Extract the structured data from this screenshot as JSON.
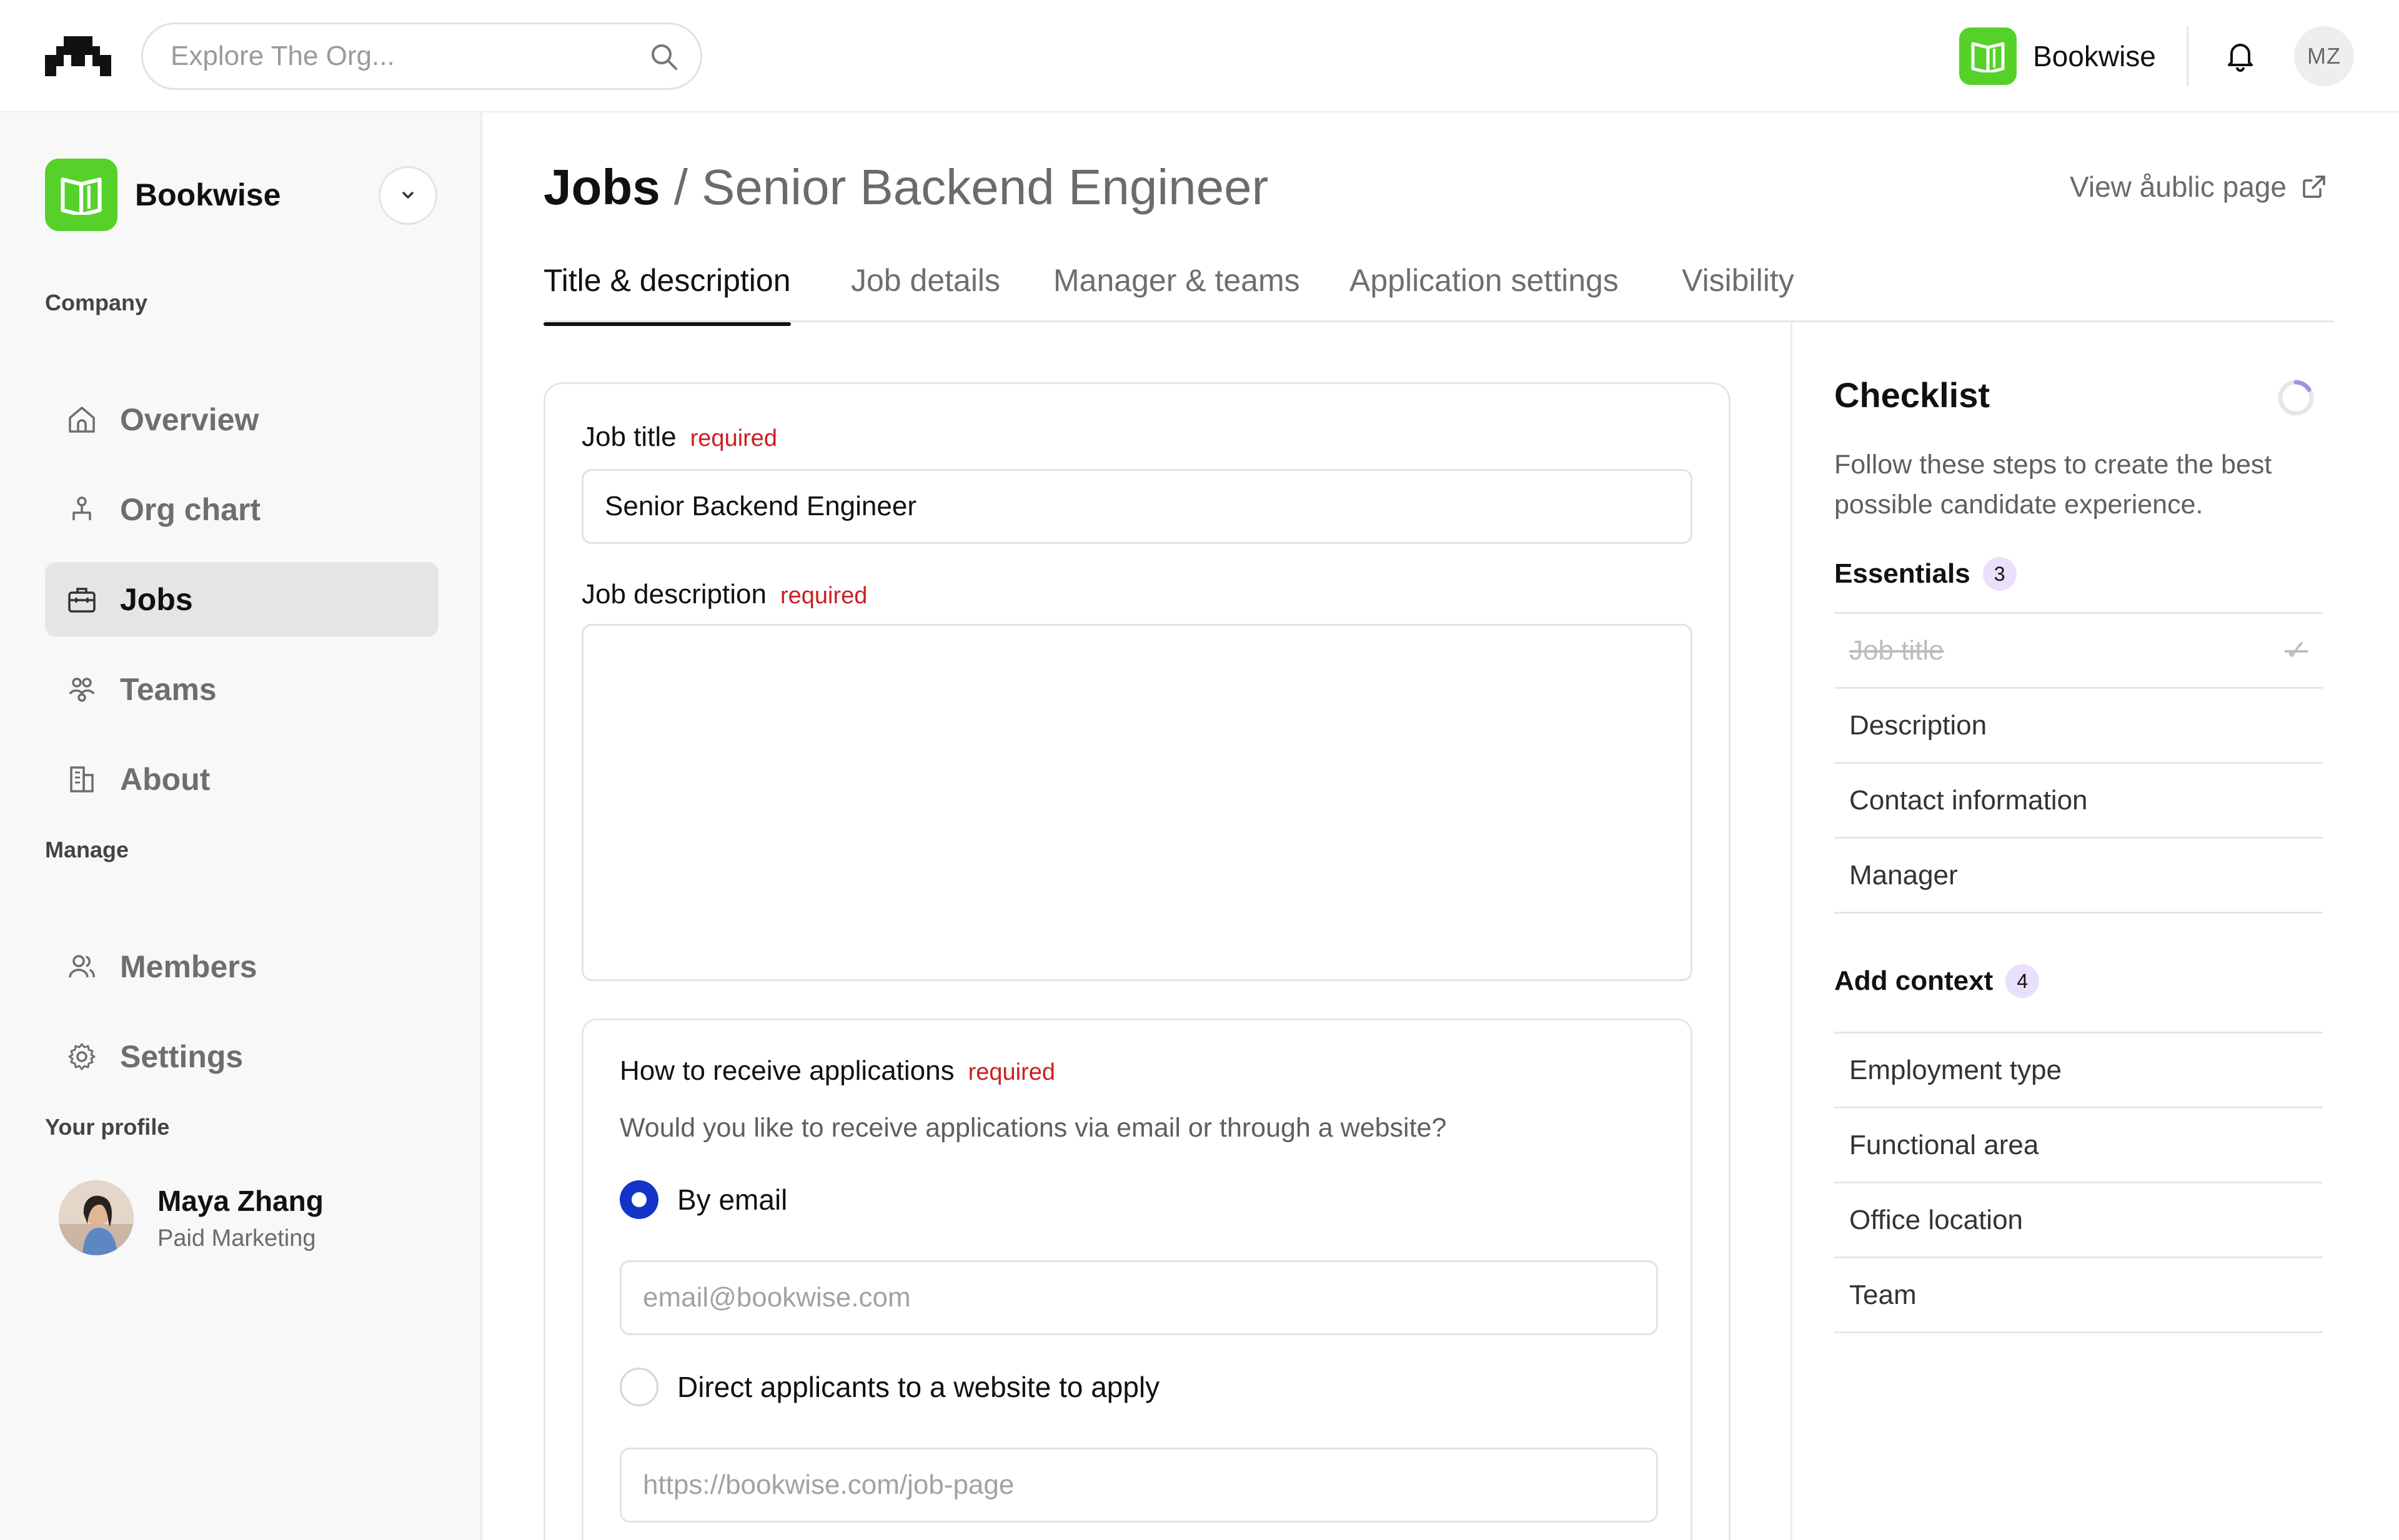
{
  "header": {
    "search_placeholder": "Explore The Org...",
    "org_name": "Bookwise",
    "user_initials": "MZ"
  },
  "sidebar": {
    "org_name": "Bookwise",
    "sections": {
      "company": "Company",
      "manage": "Manage",
      "profile": "Your profile"
    },
    "items": [
      {
        "label": "Overview",
        "icon": "home-icon"
      },
      {
        "label": "Org chart",
        "icon": "org-chart-icon"
      },
      {
        "label": "Jobs",
        "icon": "briefcase-icon",
        "active": true
      },
      {
        "label": "Teams",
        "icon": "teams-icon"
      },
      {
        "label": "About",
        "icon": "building-icon"
      },
      {
        "label": "Members",
        "icon": "members-icon"
      },
      {
        "label": "Settings",
        "icon": "gear-icon"
      }
    ],
    "profile": {
      "name": "Maya Zhang",
      "role": "Paid Marketing"
    }
  },
  "page": {
    "section": "Jobs",
    "separator": "/",
    "job_name": "Senior Backend Engineer",
    "view_public": "View åublic page"
  },
  "tabs": [
    {
      "label": "Title & description",
      "active": true
    },
    {
      "label": "Job details"
    },
    {
      "label": "Manager & teams"
    },
    {
      "label": "Application settings"
    },
    {
      "label": "Visibility"
    }
  ],
  "form": {
    "required_label": "required",
    "job_title_label": "Job title",
    "job_title_value": "Senior Backend Engineer",
    "job_description_label": "Job description",
    "job_description_value": "",
    "applications": {
      "label": "How to receive applications",
      "help": "Would you like to receive applications via email or through a website?",
      "option_email": "By email",
      "email_placeholder": "email@bookwise.com",
      "option_website": "Direct applicants to a website to apply",
      "website_placeholder": "https://bookwise.com/job-page",
      "selected": "email"
    }
  },
  "checklist": {
    "title": "Checklist",
    "description": "Follow these steps to create the best possible candidate experience.",
    "essentials": {
      "label": "Essentials",
      "count": "3",
      "items": [
        {
          "label": "Job title",
          "done": true
        },
        {
          "label": "Description"
        },
        {
          "label": "Contact information"
        },
        {
          "label": "Manager"
        }
      ]
    },
    "context": {
      "label": "Add context",
      "count": "4",
      "items": [
        {
          "label": "Employment type"
        },
        {
          "label": "Functional area"
        },
        {
          "label": "Office location"
        },
        {
          "label": "Team"
        }
      ]
    }
  },
  "colors": {
    "brand": "#55d12a",
    "radio_selected": "#1434c8",
    "required": "#cc1f1f",
    "count_badge": "#e9e0fb",
    "spinner_accent": "#a98be8"
  }
}
